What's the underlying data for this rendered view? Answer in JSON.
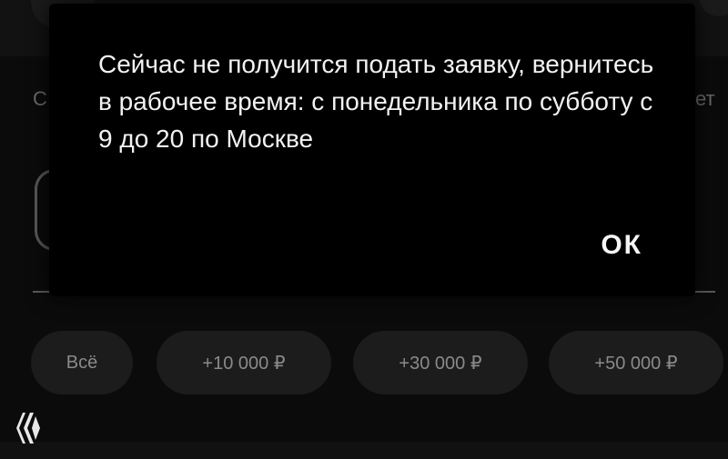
{
  "background": {
    "chips": [
      {
        "label": "Всё"
      },
      {
        "label": "+10 000 ₽"
      },
      {
        "label": "+30 000 ₽"
      },
      {
        "label": "+50 000 ₽"
      }
    ],
    "partial_left_text": "С",
    "partial_right_text": "ет",
    "logo_icon": "app-logo-icon"
  },
  "dialog": {
    "message": "Сейчас не получится подать заявку, вернитесь в рабочее время: с понедельника по субботу с 9 до 20 по Москве",
    "ok_label": "ОК"
  },
  "colors": {
    "background": "#0b0b0b",
    "dialog": "#000000",
    "chip": "#1c1c1c",
    "chip_text": "#8a8a8a",
    "text": "#f2f2f2"
  }
}
